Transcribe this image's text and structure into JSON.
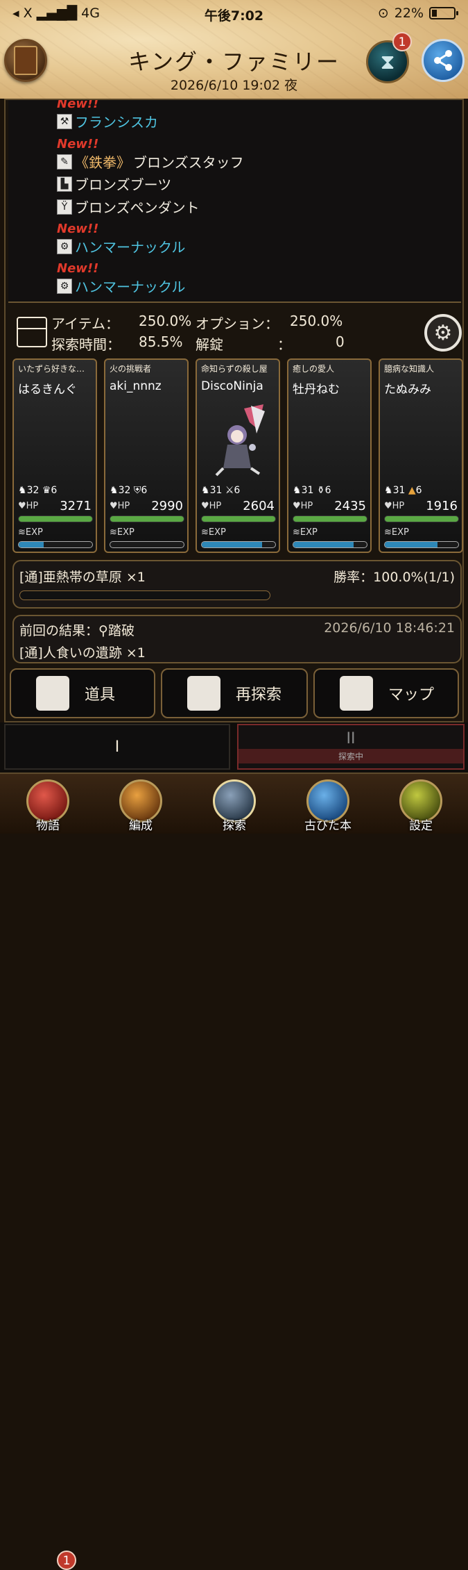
{
  "status_bar": {
    "carrier": "◂ X",
    "network": "4G",
    "time": "午後7:02",
    "battery": "22%"
  },
  "header": {
    "title": "キング・ファミリー",
    "datetime": "2026/6/10 19:02 夜",
    "hourglass_badge": "1"
  },
  "log": {
    "items": [
      {
        "new_label": "New!!",
        "icon": "⚒",
        "name": "フランシスカ",
        "highlight": true
      },
      {
        "new_label": "New!!",
        "icon": "✎",
        "prefix": "《鉄拳》",
        "name": "ブロンズスタッフ",
        "highlight": false
      },
      {
        "new_label": "",
        "icon": "▙",
        "name": "ブロンズブーツ",
        "highlight": false
      },
      {
        "new_label": "",
        "icon": "Ÿ",
        "name": "ブロンズペンダント",
        "highlight": false
      },
      {
        "new_label": "New!!",
        "icon": "⚙",
        "name": "ハンマーナックル",
        "highlight": true
      },
      {
        "new_label": "New!!",
        "icon": "⚙",
        "name": "ハンマーナックル",
        "highlight": true
      }
    ]
  },
  "stats": {
    "item_label": "アイテム：",
    "item_value": "250.0%",
    "option_label": "オプション：",
    "option_value": "250.0%",
    "time_label": "探索時間：",
    "time_value": "85.5%",
    "unlock_label": "解錠",
    "unlock_sep": "：",
    "unlock_value": "0"
  },
  "party": [
    {
      "title": "いたずら好きな…",
      "name": "はるきんぐ",
      "level": "32",
      "rank": "6",
      "hp_label": "HP",
      "hp": "3271",
      "exp_label": "EXP",
      "exp_ratio": 0.34
    },
    {
      "title": "火の挑戦者",
      "name": "aki_nnnz",
      "level": "32",
      "rank": "6",
      "hp_label": "HP",
      "hp": "2990",
      "exp_label": "EXP",
      "exp_ratio": 0.0
    },
    {
      "title": "命知らずの殺し屋",
      "name": "DiscoNinja",
      "level": "31",
      "rank": "6",
      "hp_label": "HP",
      "hp": "2604",
      "exp_label": "EXP",
      "exp_ratio": 0.82
    },
    {
      "title": "癒しの愛人",
      "name": "牡丹ねむ",
      "level": "31",
      "rank": "6",
      "hp_label": "HP",
      "hp": "2435",
      "exp_label": "EXP",
      "exp_ratio": 0.82
    },
    {
      "title": "臆病な知識人",
      "name": "たぬみみ",
      "level": "31",
      "rank": "6",
      "hp_label": "HP",
      "hp": "1916",
      "exp_label": "EXP",
      "exp_ratio": 0.72
    }
  ],
  "quest": {
    "name": "[通]亜熱帯の草原 ×1",
    "win_rate": "勝率：100.0%(1/1)",
    "progress": 0.0
  },
  "last_result": {
    "label": "前回の結果：",
    "result": "踏破",
    "timestamp": "2026/6/10 18:46:21",
    "dungeon": "[通]人食いの遺跡 ×1"
  },
  "actions": {
    "tools": "道具",
    "re_explore": "再探索",
    "map": "マップ"
  },
  "tabs": {
    "tab1": "I",
    "tab2": "II",
    "tab2_status": "探索中"
  },
  "bottom_nav": {
    "story": "物語",
    "story_badge": "1",
    "formation": "編成",
    "explore": "探索",
    "old_book": "古びた本",
    "settings": "設定"
  },
  "colors": {
    "hp_bar": "#5aa844",
    "exp_bar": "#2e88b8",
    "new_label": "#e0392b",
    "highlight_item": "#4fc3e0",
    "frame_border": "#8a6a3a"
  }
}
